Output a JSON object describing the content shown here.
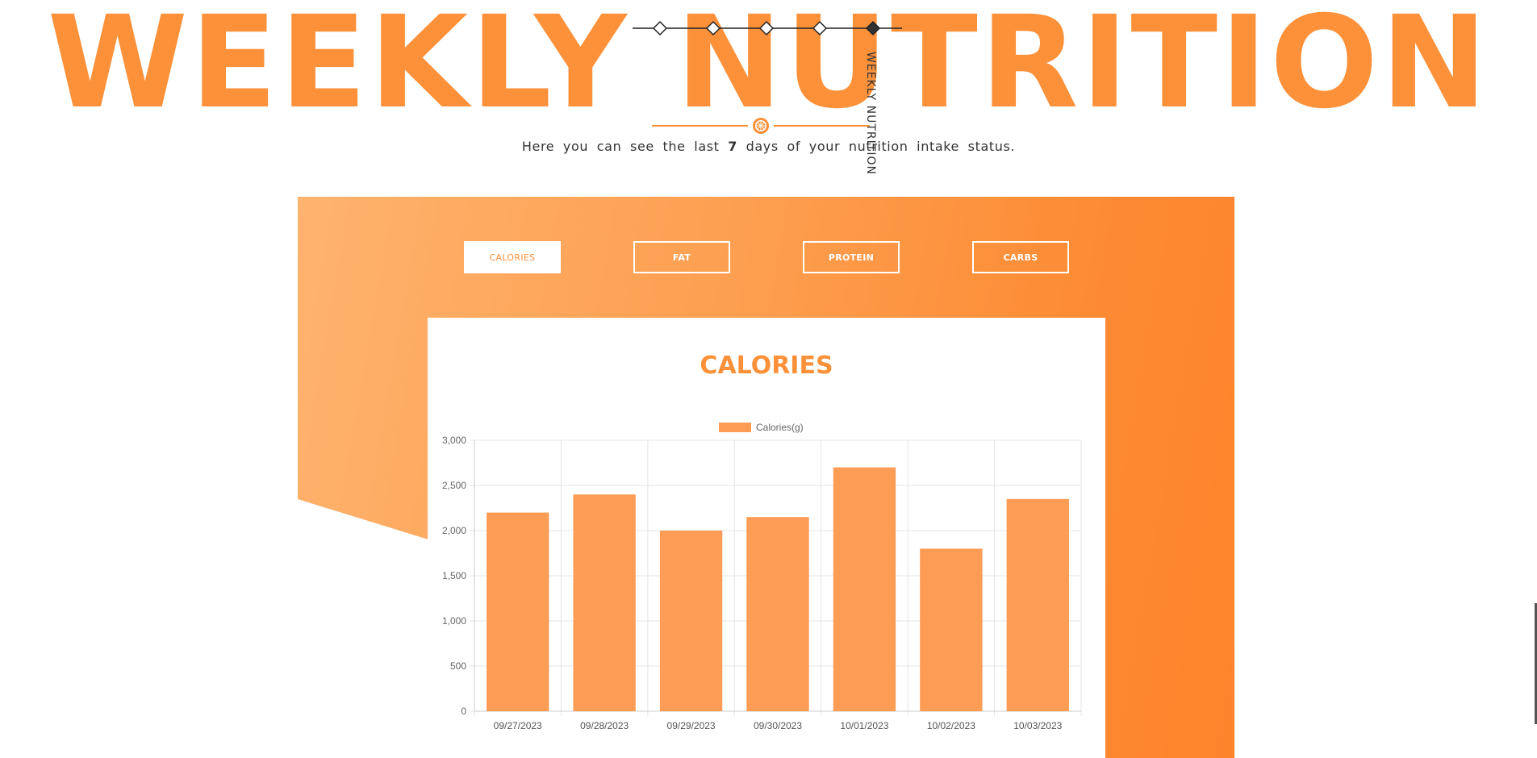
{
  "hero": {
    "title": "WEEKLY NUTRITION",
    "vertical_label": "WEEKLY NUTRITION",
    "subtitle_before": "Here you can see the last ",
    "subtitle_number": "7",
    "subtitle_after": " days of your nutrition intake status."
  },
  "step_nav": {
    "steps": 5,
    "active_index": 4
  },
  "tabs": [
    {
      "label": "CALORIES",
      "active": true
    },
    {
      "label": "FAT",
      "active": false
    },
    {
      "label": "PROTEIN",
      "active": false
    },
    {
      "label": "CARBS",
      "active": false
    }
  ],
  "colors": {
    "accent": "#fc913a",
    "bar_fill": "#fd9c54",
    "panel_light": "#feb36e",
    "panel_dark": "#fd842b",
    "text_dark": "#333333"
  },
  "chart": {
    "heading": "CALORIES"
  },
  "chart_data": {
    "type": "bar",
    "title": "",
    "xlabel": "",
    "ylabel": "",
    "legend": {
      "label": "Calories(g)",
      "placement": "top"
    },
    "categories": [
      "09/27/2023",
      "09/28/2023",
      "09/29/2023",
      "09/30/2023",
      "10/01/2023",
      "10/02/2023",
      "10/03/2023"
    ],
    "series": [
      {
        "name": "Calories(g)",
        "values": [
          2200,
          2400,
          2000,
          2150,
          2700,
          1800,
          2350
        ]
      }
    ],
    "ylim": [
      0,
      3000
    ],
    "yticks": [
      0,
      500,
      1000,
      1500,
      2000,
      2500,
      3000
    ],
    "ytick_labels": [
      "0",
      "500",
      "1,000",
      "1,500",
      "2,000",
      "2,500",
      "3,000"
    ],
    "grid": true
  }
}
